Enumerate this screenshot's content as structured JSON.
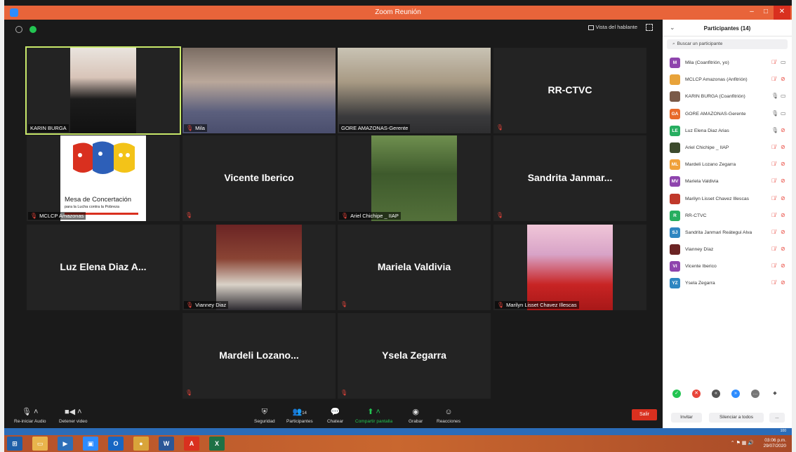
{
  "window": {
    "title": "Zoom Reunión",
    "minimize": "–",
    "maximize": "□",
    "close": "✕"
  },
  "meeting": {
    "view_label": "Vista del hablante",
    "tiles": [
      {
        "name": "KARIN BURGA",
        "type": "video",
        "photo": "karin"
      },
      {
        "name": "Mila",
        "type": "video",
        "photo": "mila"
      },
      {
        "name": "GORE AMAZONAS-Gerente",
        "type": "video",
        "photo": "gore"
      },
      {
        "name": "RR-CTVC",
        "type": "name"
      },
      {
        "name": "MCLCP Amazonas",
        "type": "logo"
      },
      {
        "name": "Vicente Iberico",
        "type": "name"
      },
      {
        "name": "Ariel Chichipe _ IIAP",
        "type": "video",
        "photo": "ariel"
      },
      {
        "name": "Sandrita Janmar...",
        "type": "name"
      },
      {
        "name": "Luz Elena Diaz A...",
        "type": "name"
      },
      {
        "name": "Vianney Diaz",
        "type": "video",
        "photo": "vianney"
      },
      {
        "name": "Mariela Valdivia",
        "type": "name"
      },
      {
        "name": "Marilyn Lisset Chavez Illescas",
        "type": "video",
        "photo": "marilyn"
      },
      {
        "name": "Mardeli Lozano...",
        "type": "name"
      },
      {
        "name": "Ysela Zegarra",
        "type": "name"
      }
    ],
    "logo": {
      "title": "Mesa de Concertación",
      "subtitle": "para la Lucha contra la Pobreza"
    }
  },
  "toolbar": {
    "audio": "Re-iniciar Audio",
    "video": "Detener video",
    "security": "Seguridad",
    "participants": "Participantes",
    "participants_count": "14",
    "chat": "Chatear",
    "share": "Compartir pantalla",
    "record": "Grabar",
    "reactions": "Reacciones",
    "leave": "Salir"
  },
  "panel": {
    "title": "Participantes (14)",
    "search_placeholder": "Buscar un participante",
    "participants": [
      {
        "initials": "M",
        "name": "Mila (Coanfitrión, yo)",
        "color": "#8e44ad",
        "mic": "muted",
        "cam": "on"
      },
      {
        "initials": "",
        "name": "MCLCP Amazonas (Anfitrión)",
        "color": "#e8a33a",
        "mic": "muted",
        "cam": "off"
      },
      {
        "initials": "",
        "name": "KARIN BURGA (Coanfitrión)",
        "color": "#7a5a48",
        "mic": "on",
        "cam": "on"
      },
      {
        "initials": "GA",
        "name": "GORE AMAZONAS-Gerente",
        "color": "#e86a2a",
        "mic": "on",
        "cam": "on"
      },
      {
        "initials": "LE",
        "name": "Luz Elena Diaz Arias",
        "color": "#27ae60",
        "mic": "on",
        "cam": "off"
      },
      {
        "initials": "",
        "name": "Ariel Chichipe _ IIAP",
        "color": "#3c4a2c",
        "mic": "muted",
        "cam": "off"
      },
      {
        "initials": "ML",
        "name": "Mardeli Lozano Zegarra",
        "color": "#f0a13a",
        "mic": "muted",
        "cam": "off"
      },
      {
        "initials": "MV",
        "name": "Mariela Valdivia",
        "color": "#8e44ad",
        "mic": "muted",
        "cam": "off"
      },
      {
        "initials": "",
        "name": "Marilyn Lisset Chavez Illescas",
        "color": "#c0392b",
        "mic": "muted",
        "cam": "off"
      },
      {
        "initials": "R",
        "name": "RR-CTVC",
        "color": "#27ae60",
        "mic": "muted",
        "cam": "off"
      },
      {
        "initials": "SJ",
        "name": "Sandrita Janmari Reátegui Alva",
        "color": "#2e86c1",
        "mic": "muted",
        "cam": "off"
      },
      {
        "initials": "",
        "name": "Vianney Díaz",
        "color": "#6b2424",
        "mic": "muted",
        "cam": "off"
      },
      {
        "initials": "VI",
        "name": "Vicente Iberico",
        "color": "#8e44ad",
        "mic": "muted",
        "cam": "off"
      },
      {
        "initials": "YZ",
        "name": "Ysela Zegarra",
        "color": "#2e86c1",
        "mic": "muted",
        "cam": "off"
      }
    ],
    "invite": "Invitar",
    "mute_all": "Silenciar a todos",
    "more": "..."
  },
  "taskbar": {
    "time": "03:06 p.m.",
    "date": "29/07/2020",
    "zoom_level": "100"
  },
  "colors": {
    "accent": "#2d8cff",
    "active_speaker": "#c8e86a",
    "muted": "#e8443a",
    "leave": "#d9301f"
  }
}
